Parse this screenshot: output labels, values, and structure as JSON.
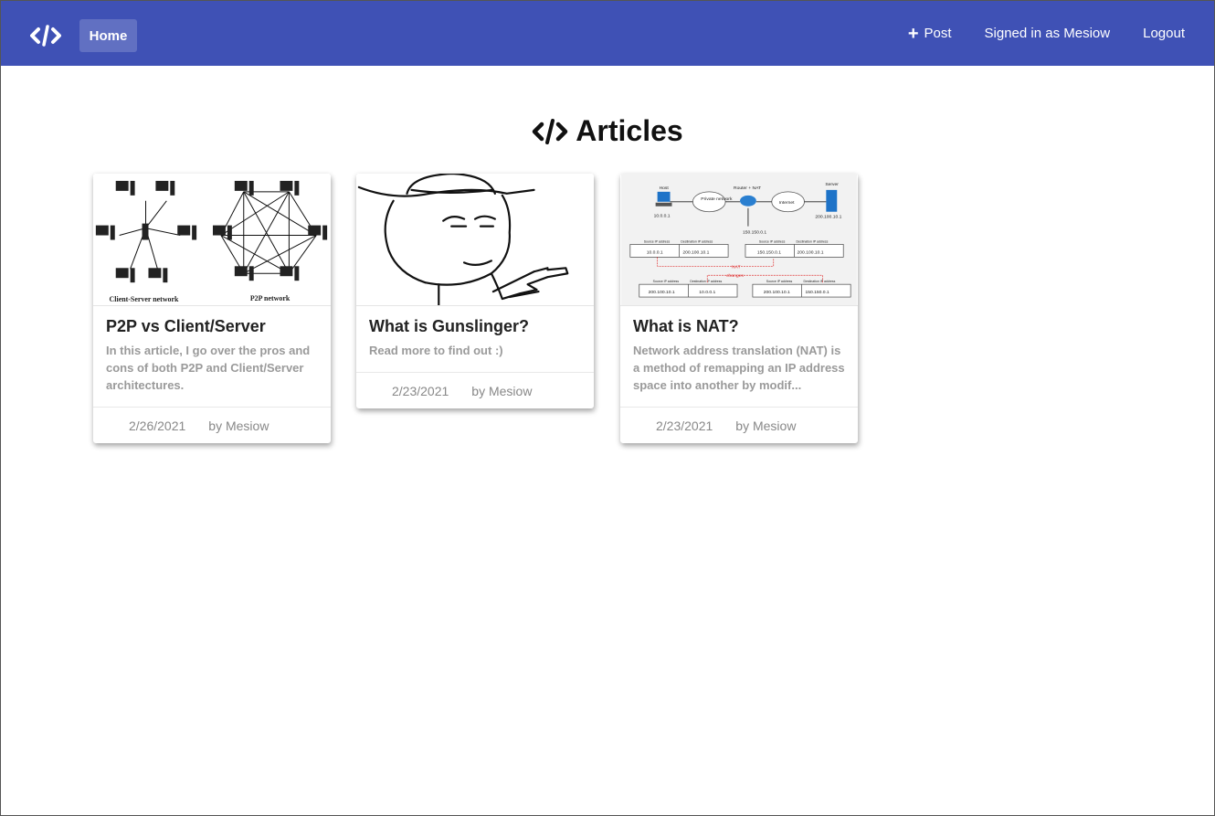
{
  "nav": {
    "home_label": "Home",
    "post_label": "Post",
    "signed_in_label": "Signed in as Mesiow",
    "logout_label": "Logout"
  },
  "page": {
    "title": "Articles"
  },
  "articles": [
    {
      "title": "P2P vs Client/Server",
      "description": "In this article, I go over the pros and cons of both P2P and Client/Server architectures.",
      "date": "2/26/2021",
      "author": "by Mesiow",
      "image_labels": [
        "Client-Server network",
        "P2P network"
      ]
    },
    {
      "title": "What is Gunslinger?",
      "description": "Read more to find out :)",
      "date": "2/23/2021",
      "author": "by Mesiow"
    },
    {
      "title": "What is NAT?",
      "description": "Network address translation (NAT) is a method of remapping an IP address space into another by modif...",
      "date": "2/23/2021",
      "author": "by Mesiow",
      "image_labels": {
        "host": "Host",
        "private": "Private network",
        "router": "Router + NAT",
        "internet": "Internet",
        "server": "Server",
        "host_ip": "10.0.0.1",
        "server_ip": "200.100.10.1",
        "router_ip": "150.150.0.1",
        "src": "Source IP address",
        "dst": "Destination IP address",
        "nat": "NAT",
        "changes": "changes"
      }
    }
  ],
  "colors": {
    "navbar": "#3f51b5",
    "muted": "#9a9a9a"
  }
}
